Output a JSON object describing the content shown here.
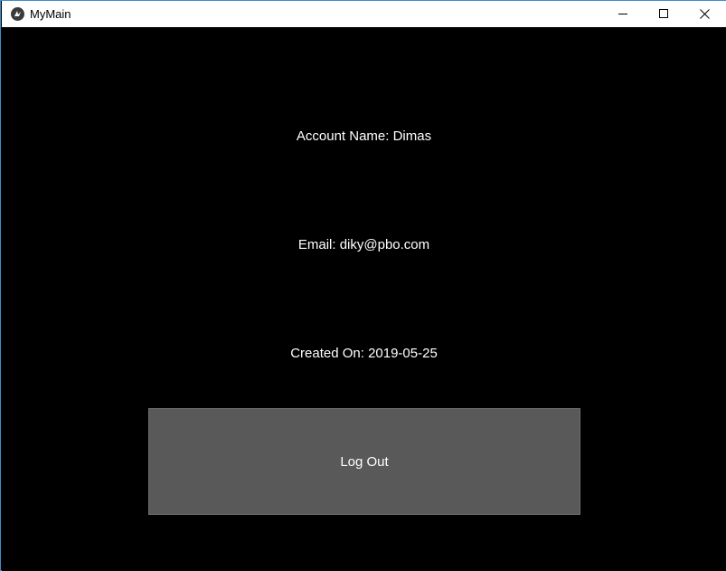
{
  "window": {
    "title": "MyMain",
    "controls": {
      "minimize": "minimize-icon",
      "maximize": "maximize-icon",
      "close": "close-icon"
    }
  },
  "account": {
    "name_text": "Account Name: Dimas",
    "email_text": "Email: diky@pbo.com",
    "created_text": "Created On: 2019-05-25"
  },
  "actions": {
    "logout_label": "Log Out"
  },
  "colors": {
    "background": "#000000",
    "button": "#595959",
    "text": "#ffffff",
    "titlebar": "#ffffff"
  }
}
